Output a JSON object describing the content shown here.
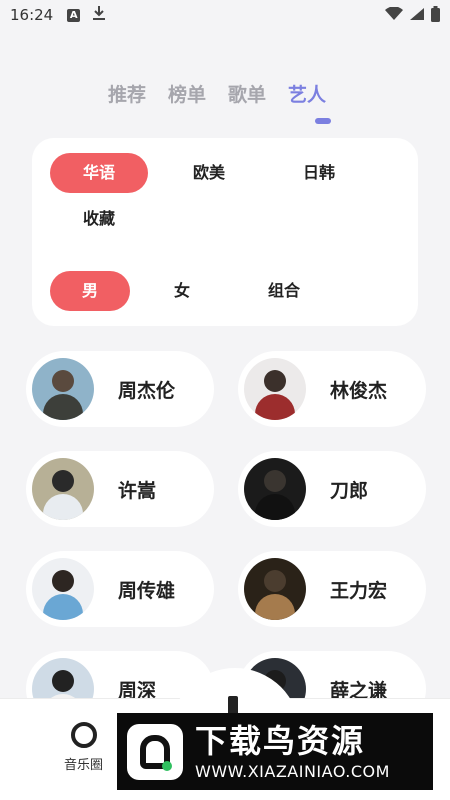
{
  "status_bar": {
    "time": "16:24",
    "a_icon_text": "A"
  },
  "top_tabs": [
    {
      "label": "推荐",
      "active": false
    },
    {
      "label": "榜单",
      "active": false
    },
    {
      "label": "歌单",
      "active": false
    },
    {
      "label": "艺人",
      "active": true
    }
  ],
  "filters": {
    "region": [
      {
        "label": "华语",
        "active": true
      },
      {
        "label": "欧美",
        "active": false
      },
      {
        "label": "日韩",
        "active": false
      },
      {
        "label": "收藏",
        "active": false
      }
    ],
    "gender": [
      {
        "label": "男",
        "active": true
      },
      {
        "label": "女",
        "active": false
      },
      {
        "label": "组合",
        "active": false
      }
    ]
  },
  "artists": [
    {
      "name": "周杰伦",
      "avatar": {
        "bg": "#8fb3c9",
        "head": "#5a4a3e",
        "body": "#3d3f3a"
      }
    },
    {
      "name": "林俊杰",
      "avatar": {
        "bg": "#eceaea",
        "head": "#3b302b",
        "body": "#9c2d2d"
      }
    },
    {
      "name": "许嵩",
      "avatar": {
        "bg": "#b7b096",
        "head": "#2a2a2a",
        "body": "#e8ecf0"
      }
    },
    {
      "name": "刀郎",
      "avatar": {
        "bg": "#1b1b1b",
        "head": "#3a3530",
        "body": "#111111"
      }
    },
    {
      "name": "周传雄",
      "avatar": {
        "bg": "#eef0f3",
        "head": "#2d2622",
        "body": "#6aa7d4"
      }
    },
    {
      "name": "王力宏",
      "avatar": {
        "bg": "#2a2218",
        "head": "#4b3d2f",
        "body": "#a57b4d"
      }
    },
    {
      "name": "周深",
      "avatar": {
        "bg": "#cfdbe6",
        "head": "#222222",
        "body": "#f2f2f2"
      }
    },
    {
      "name": "薛之谦",
      "avatar": {
        "bg": "#2b2f35",
        "head": "#1c1c1c",
        "body": "#3c4350"
      }
    }
  ],
  "bottom_nav": {
    "music_circle_label": "音乐圈"
  },
  "watermark": {
    "title": "下载鸟资源",
    "url": "WWW.XIAZAINIAO.COM"
  },
  "colors": {
    "accent": "#7b7fe0",
    "chip_active": "#f15f63",
    "background": "#f4f4f6"
  }
}
